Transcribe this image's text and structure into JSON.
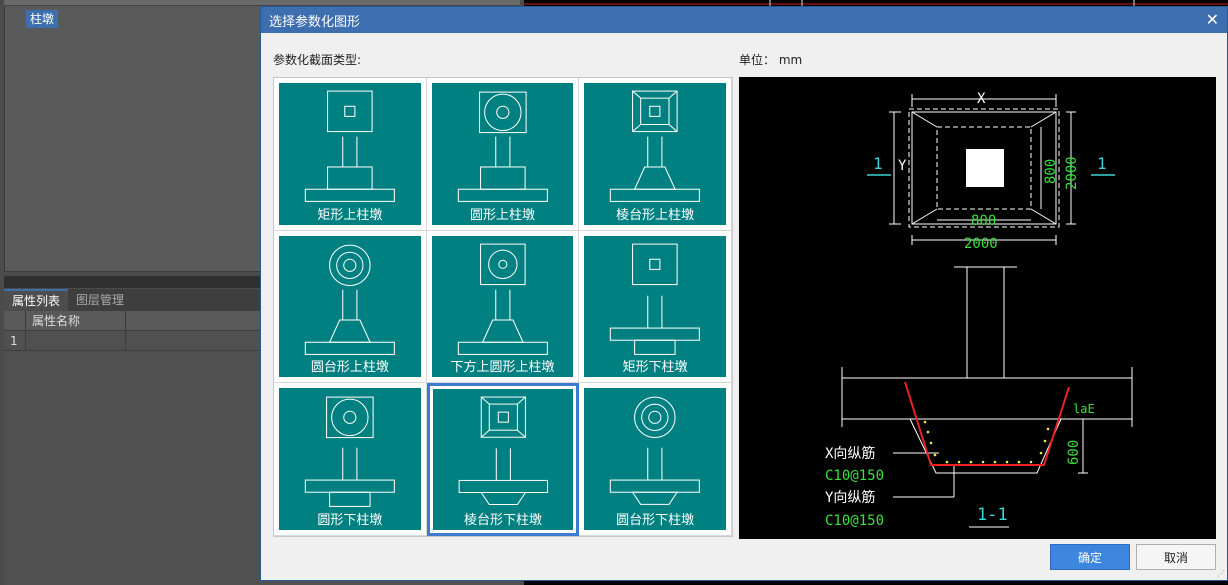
{
  "background": {
    "tag": "柱墩",
    "tabs": [
      "属性列表",
      "图层管理"
    ],
    "table_header": "属性名称",
    "row_number": "1"
  },
  "dialog": {
    "title": "选择参数化图形",
    "type_label": "参数化截面类型:",
    "unit_label": "单位：",
    "unit_value": "mm",
    "ok_label": "确定",
    "cancel_label": "取消",
    "selected_index": 7
  },
  "shapes": [
    {
      "label": "矩形上柱墩"
    },
    {
      "label": "圆形上柱墩"
    },
    {
      "label": "棱台形上柱墩"
    },
    {
      "label": "圆台形上柱墩"
    },
    {
      "label": "下方上圆形上柱墩"
    },
    {
      "label": "矩形下柱墩"
    },
    {
      "label": "圆形下柱墩"
    },
    {
      "label": "棱台形下柱墩"
    },
    {
      "label": "圆台形下柱墩"
    }
  ],
  "preview": {
    "dim_x": "X",
    "dim_y": "Y",
    "dim_inner_w": "800",
    "dim_outer_w": "2000",
    "dim_inner_h": "800",
    "dim_outer_h": "2000",
    "section_mark": "1",
    "lae": "laE",
    "depth": "600",
    "x_rebar_label": "X向纵筋",
    "x_rebar_spec": "C10@150",
    "y_rebar_label": "Y向纵筋",
    "y_rebar_spec": "C10@150",
    "section_title": "1-1"
  }
}
